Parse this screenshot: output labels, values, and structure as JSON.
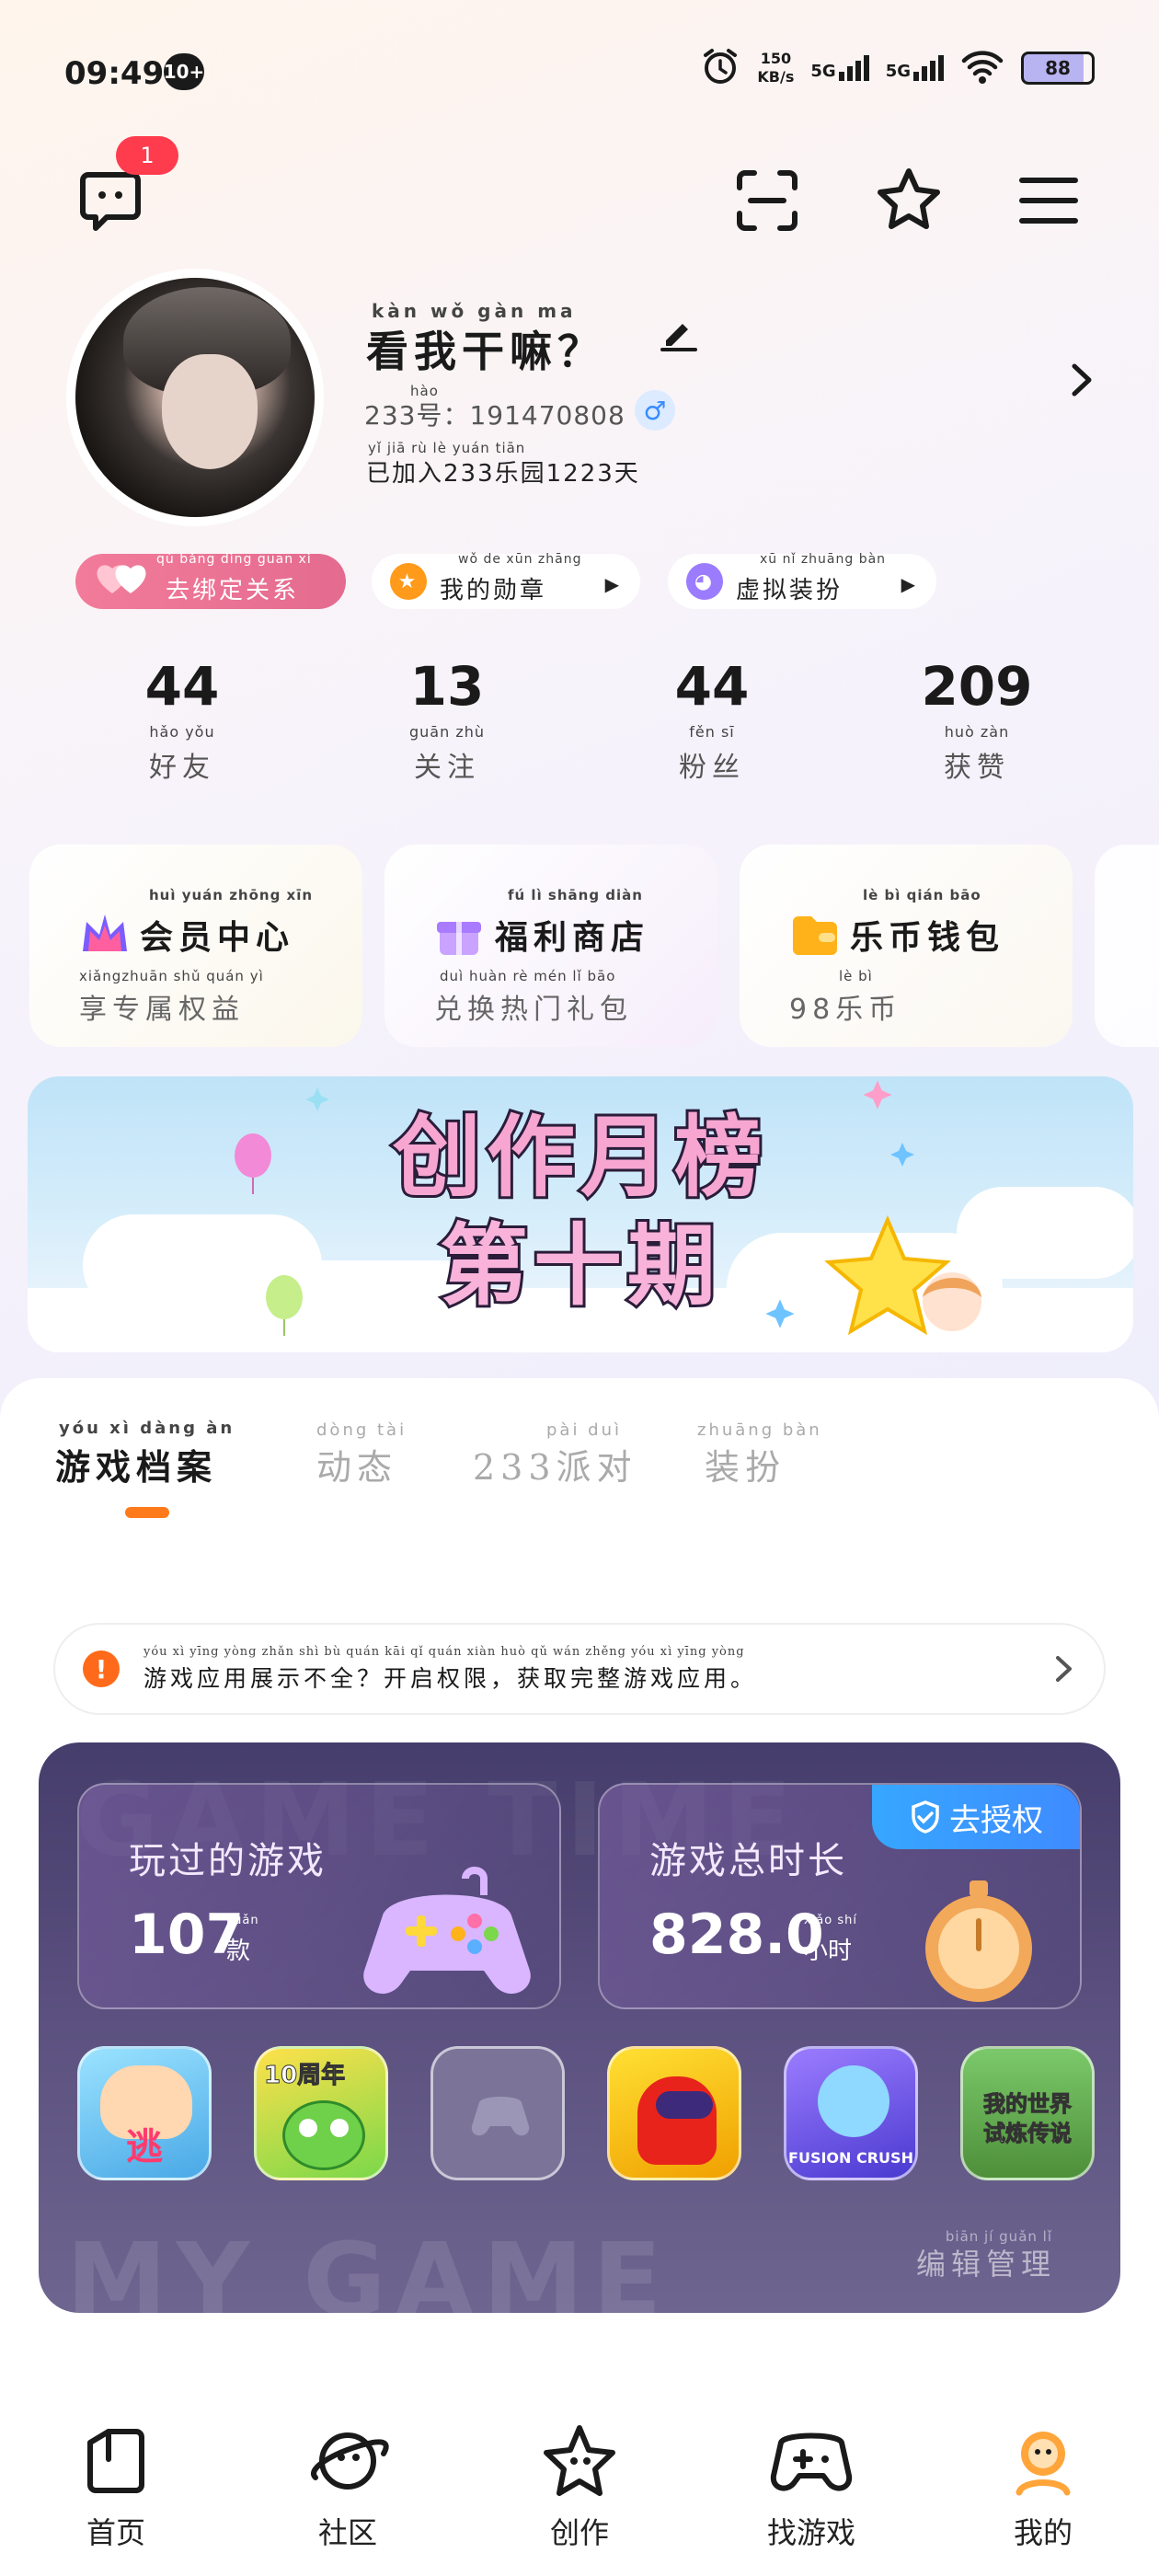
{
  "status_bar": {
    "time": "09:49",
    "notif_badge": "10+",
    "net_speed_value": "150",
    "net_speed_unit": "KB/s",
    "signal_1": "5G",
    "signal_2": "5G",
    "battery": "88"
  },
  "top_bar": {
    "message_badge": "1"
  },
  "profile": {
    "nickname_pinyin": "kàn  wǒ  gàn  ma",
    "nickname": "看我干嘛？",
    "id_pinyin": "hào",
    "id_label": "233号：",
    "id_value": "191470808",
    "joined_pinyin": "yǐ  jiā  rù          lè  yuán               tiān",
    "joined_text": "已加入233乐园1223天",
    "chips": [
      {
        "pinyin": "qù bǎng dìng guān xì",
        "label": "去绑定关系"
      },
      {
        "pinyin": "wǒ  de  xūn zhāng",
        "label": "我的勋章"
      },
      {
        "pinyin": "xū  nǐ zhuāng bàn",
        "label": "虚拟装扮"
      }
    ],
    "stats": [
      {
        "value": "44",
        "pinyin": "hǎo  yǒu",
        "label": "好友"
      },
      {
        "value": "13",
        "pinyin": "guān  zhù",
        "label": "关注"
      },
      {
        "value": "44",
        "pinyin": "fěn  sī",
        "label": "粉丝"
      },
      {
        "value": "209",
        "pinyin": "huò  zàn",
        "label": "获赞"
      }
    ]
  },
  "feature_cards": [
    {
      "title_pinyin": "huì  yuán zhōng  xīn",
      "title": "会员中心",
      "sub_pinyin": "xiǎngzhuān shǔ  quán  yì",
      "sub": "享专属权益",
      "color": "#7b5cff"
    },
    {
      "title_pinyin": "fú    lì  shāng diàn",
      "title": "福利商店",
      "sub_pinyin": "duì  huàn  rè   mén   lǐ   bāo",
      "sub": "兑换热门礼包",
      "color": "#c08cff"
    },
    {
      "title_pinyin": "lè   bì  qián  bāo",
      "title": "乐币钱包",
      "sub_pinyin": "lè  bì",
      "sub": "98乐币",
      "color": "#ffb21a"
    }
  ],
  "banner": {
    "line1": "创作月榜",
    "line2": "第十期"
  },
  "tabs": [
    {
      "pinyin": "yóu  xì  dàng  àn",
      "label": "游戏档案",
      "active": true
    },
    {
      "pinyin": "dòng  tài",
      "label": "动态",
      "active": false
    },
    {
      "pinyin": "pài  duì",
      "label": "233派对",
      "active": false
    },
    {
      "pinyin": "zhuāng  bàn",
      "label": "装扮",
      "active": false
    }
  ],
  "notice": {
    "pinyin": "yóu xì yīng yòng zhǎn shì bù quán   kāi qǐ quán xiàn   huò qǔ wán zhěng yóu xì yīng yòng",
    "text": "游戏应用展示不全？开启权限，获取完整游戏应用。"
  },
  "game_panel": {
    "watermark_top": "GAME TIME",
    "watermark_bottom": "MY GAME",
    "played_title": "玩过的游戏",
    "played_value": "107",
    "played_unit_pinyin": "kuǎn",
    "played_unit": "款",
    "duration_title": "游戏总时长",
    "duration_value": "828.0",
    "duration_unit_pinyin": "xiǎo shí",
    "duration_unit": "小时",
    "auth_button": "去授权",
    "edit_pinyin": "biān  jí  guǎn  lǐ",
    "edit_label": "编辑管理",
    "games": [
      {
        "name": "逃",
        "bg": "#6bd0f5"
      },
      {
        "name": "10周年",
        "bg": "#7ad84a"
      },
      {
        "name": "",
        "bg": "#6b6490"
      },
      {
        "name": "",
        "bg": "#f2b800"
      },
      {
        "name": "FUSION CRUSH",
        "bg": "#6a5cff"
      },
      {
        "name": "我的世界 试炼传说",
        "bg": "#5aa84a"
      }
    ]
  },
  "bottom_nav": [
    {
      "label": "首页",
      "icon": "home-icon"
    },
    {
      "label": "社区",
      "icon": "planet-icon"
    },
    {
      "label": "创作",
      "icon": "star-icon"
    },
    {
      "label": "找游戏",
      "icon": "gamepad-icon"
    },
    {
      "label": "我的",
      "icon": "profile-icon"
    }
  ]
}
